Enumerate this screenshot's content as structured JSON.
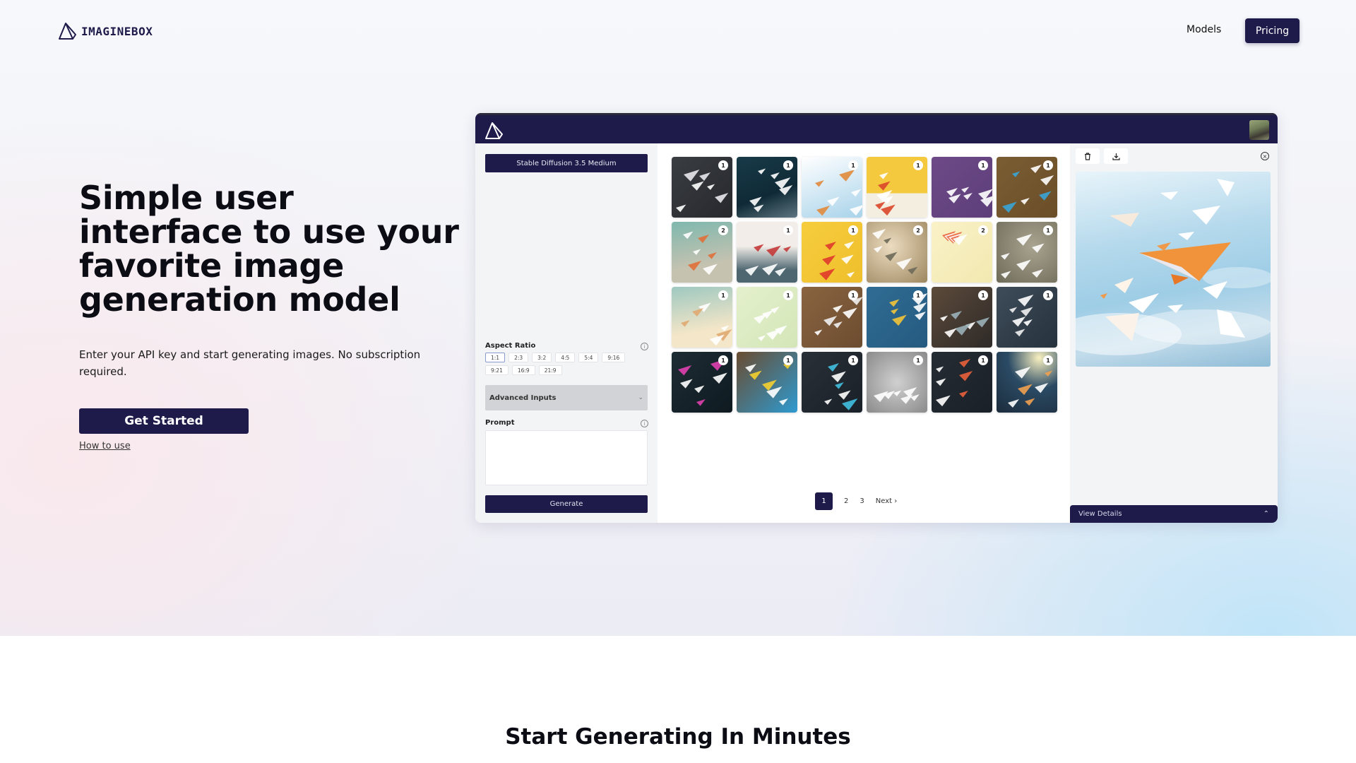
{
  "nav": {
    "brand": "IMAGINEBOX",
    "links": [
      {
        "label": "Models"
      }
    ],
    "cta": "Pricing"
  },
  "hero": {
    "title": "Simple user interface to use your favorite image generation model",
    "subtitle": "Enter your API key and start generating images. No subscription required.",
    "primary_button": "Get Started",
    "secondary_link": "How to use"
  },
  "app": {
    "model_selector": "Stable Diffusion 3.5 Medium",
    "aspect_ratio": {
      "label": "Aspect Ratio",
      "options": [
        "1:1",
        "2:3",
        "3:2",
        "4:5",
        "5:4",
        "9:16",
        "9:21",
        "16:9",
        "21:9"
      ],
      "selected": "1:1"
    },
    "advanced_inputs": "Advanced Inputs",
    "prompt": {
      "label": "Prompt",
      "value": "",
      "placeholder": ""
    },
    "generate_button": "Generate",
    "gallery": [
      {
        "count": "1",
        "bg": "linear-gradient(135deg,#3a3d42,#26282c)",
        "accent": "#e8e8ec"
      },
      {
        "count": "1",
        "bg": "linear-gradient(160deg,#183a48,#0f2a36 60%,#5f7682)",
        "accent": "#ffffff"
      },
      {
        "count": "1",
        "bg": "linear-gradient(160deg,#ffffff,#a9d3ea)",
        "accent": "#e08a3c"
      },
      {
        "count": "1",
        "bg": "linear-gradient(180deg,#f5c93e 60%,#f4eee0 60%)",
        "accent": "#d9462a"
      },
      {
        "count": "1",
        "bg": "linear-gradient(135deg,#6d4a87,#5d3e7a)",
        "accent": "#ffffff"
      },
      {
        "count": "1",
        "bg": "linear-gradient(135deg,#7b5d33,#6a4e28)",
        "accent": "#3aa5d6"
      },
      {
        "count": "2",
        "bg": "linear-gradient(170deg,#7fb8ae,#c6c2b0 70%)",
        "accent": "#e0703a"
      },
      {
        "count": "1",
        "bg": "linear-gradient(180deg,#f2ede8 40%,#4d6670 80%)",
        "accent": "#c43a3a"
      },
      {
        "count": "1",
        "bg": "linear-gradient(135deg,#f6cd3e,#efbf2c)",
        "accent": "#e03a2a"
      },
      {
        "count": "2",
        "bg": "radial-gradient(circle at 40% 40%,#ecdcc0,#9c865e)",
        "accent": "#6e6a5a"
      },
      {
        "count": "2",
        "bg": "linear-gradient(135deg,#faf2c8,#f2e8b0)",
        "accent": "#e8603c"
      },
      {
        "count": "1",
        "bg": "radial-gradient(circle at 60% 40%,#a8a490,#6e6a58)",
        "accent": "#ffffff"
      },
      {
        "count": "1",
        "bg": "linear-gradient(170deg,#9ec8c0,#f4e6c8 70%)",
        "accent": "#e0a870"
      },
      {
        "count": "1",
        "bg": "linear-gradient(135deg,#e4f0cc,#d4e6b8)",
        "accent": "#ffffff"
      },
      {
        "count": "1",
        "bg": "linear-gradient(135deg,#8a6440,#6c4c30)",
        "accent": "#f0f0f0"
      },
      {
        "count": "1",
        "bg": "linear-gradient(135deg,#2f6c94,#265a80)",
        "accent": "#f2c438"
      },
      {
        "count": "1",
        "bg": "linear-gradient(135deg,#5c4a3a,#2e2a28)",
        "accent": "#9ab0b8"
      },
      {
        "count": "1",
        "bg": "linear-gradient(135deg,#3e4c5a,#26323c)",
        "accent": "#f0f0f0"
      },
      {
        "count": "1",
        "bg": "linear-gradient(135deg,#1e2c34,#0e1a20)",
        "accent": "#e040b0"
      },
      {
        "count": "1",
        "bg": "linear-gradient(135deg,#6a4c30,#2e9ad0)",
        "accent": "#f4d030"
      },
      {
        "count": "1",
        "bg": "linear-gradient(135deg,#2a3038,#1a2028)",
        "accent": "#40c0e0"
      },
      {
        "count": "1",
        "bg": "radial-gradient(circle,#d0d0d0,#8a8a8a)",
        "accent": "#ffffff"
      },
      {
        "count": "1",
        "bg": "linear-gradient(135deg,#262c34,#1a2028)",
        "accent": "#e8603c"
      },
      {
        "count": "1",
        "bg": "radial-gradient(circle at 70% 10%,#f8f0c0,#2a4a64 45%,#1c2c3c)",
        "accent": "#f0a050"
      }
    ],
    "pagination": {
      "pages": [
        "1",
        "2",
        "3"
      ],
      "current": "1",
      "next": "Next"
    },
    "preview": {
      "view_details": "View Details"
    }
  },
  "section2": {
    "title": "Start Generating In Minutes"
  }
}
